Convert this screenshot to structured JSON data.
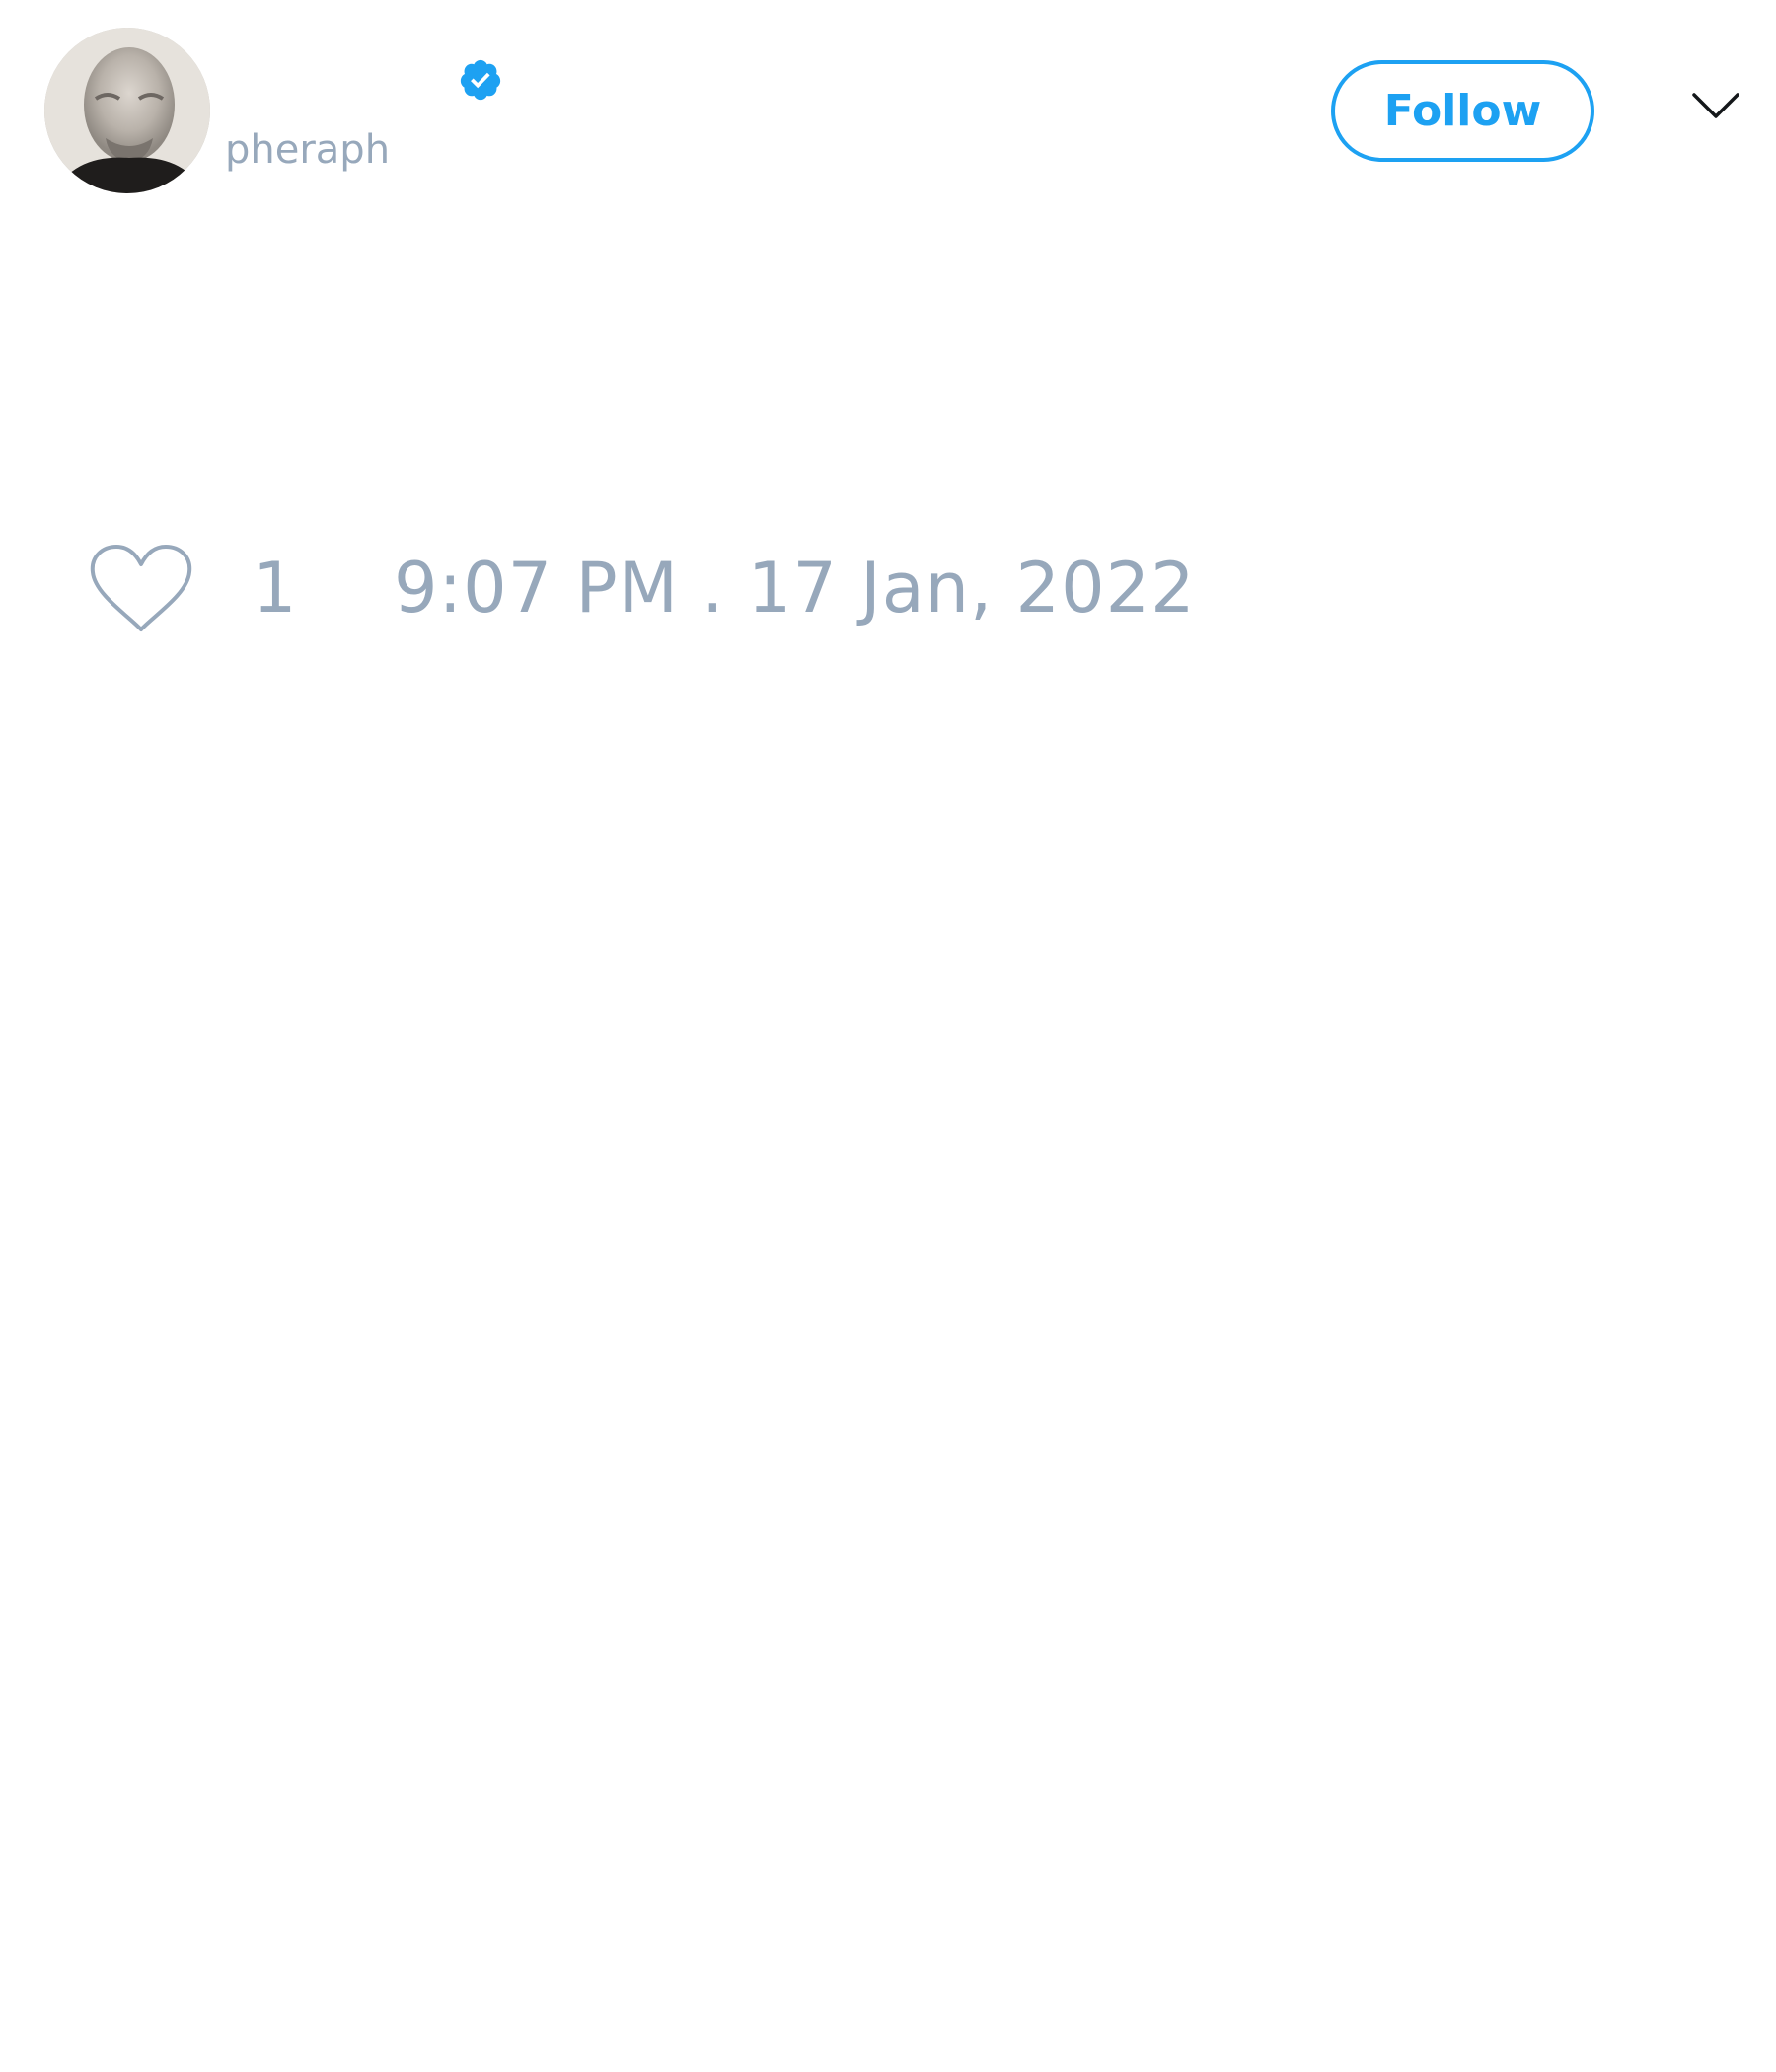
{
  "tweet": {
    "author": {
      "display_name": "",
      "handle": "pheraph",
      "verified": true,
      "avatar_icon": "user-avatar-photo"
    },
    "follow_label": "Follow",
    "menu_icon": "chevron-down-icon",
    "likes": {
      "icon": "heart-icon",
      "count": "1"
    },
    "timestamp": "9:07 PM . 17 Jan, 2022"
  },
  "colors": {
    "accent": "#1da1f2",
    "muted_text": "#97a8bb",
    "background": "#ffffff"
  }
}
